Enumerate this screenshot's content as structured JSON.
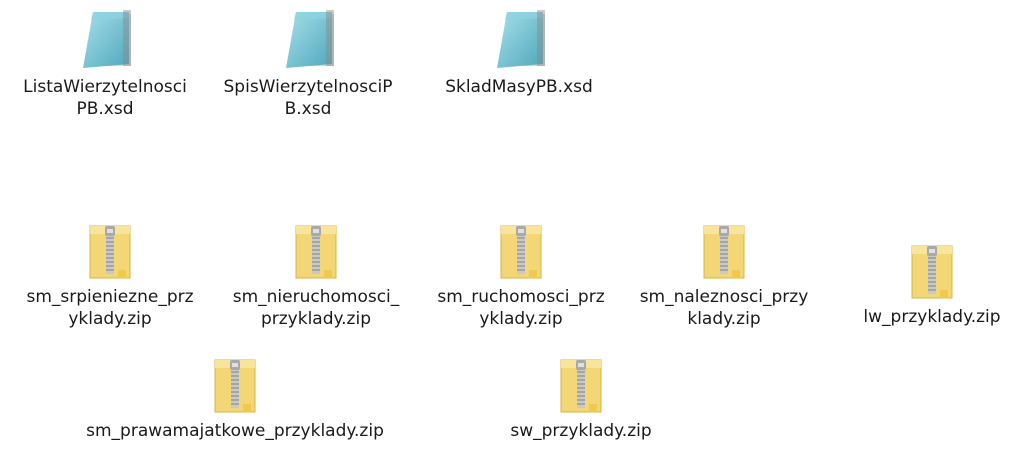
{
  "window": {
    "title": ""
  },
  "colors": {
    "background": "#ffffff",
    "label_text": "#1a1a1a",
    "doc_icon": "#7ec8d4",
    "zip_folder": "#f2d470",
    "zip_zipper": "#b8b8b8"
  },
  "files": [
    {
      "label": "ListaWierzytelnosci\nPB.xsd",
      "icon": "xsd-document-icon"
    },
    {
      "label": "SpisWierzytelnosciP\nB.xsd",
      "icon": "xsd-document-icon"
    },
    {
      "label": "SkladMasyPB.xsd",
      "icon": "xsd-document-icon"
    },
    {
      "label": "sm_srpieniezne_prz\nyklady.zip",
      "icon": "zip-folder-icon"
    },
    {
      "label": "sm_nieruchomosci_\nprzyklady.zip",
      "icon": "zip-folder-icon"
    },
    {
      "label": "sm_ruchomosci_prz\nyklady.zip",
      "icon": "zip-folder-icon"
    },
    {
      "label": "sm_naleznosci_przy\nklady.zip",
      "icon": "zip-folder-icon"
    },
    {
      "label": "lw_przyklady.zip",
      "icon": "zip-folder-icon"
    },
    {
      "label": "sm_prawamajatkowe_przyklady.zip",
      "icon": "zip-folder-icon"
    },
    {
      "label": "sw_przyklady.zip",
      "icon": "zip-folder-icon"
    }
  ]
}
